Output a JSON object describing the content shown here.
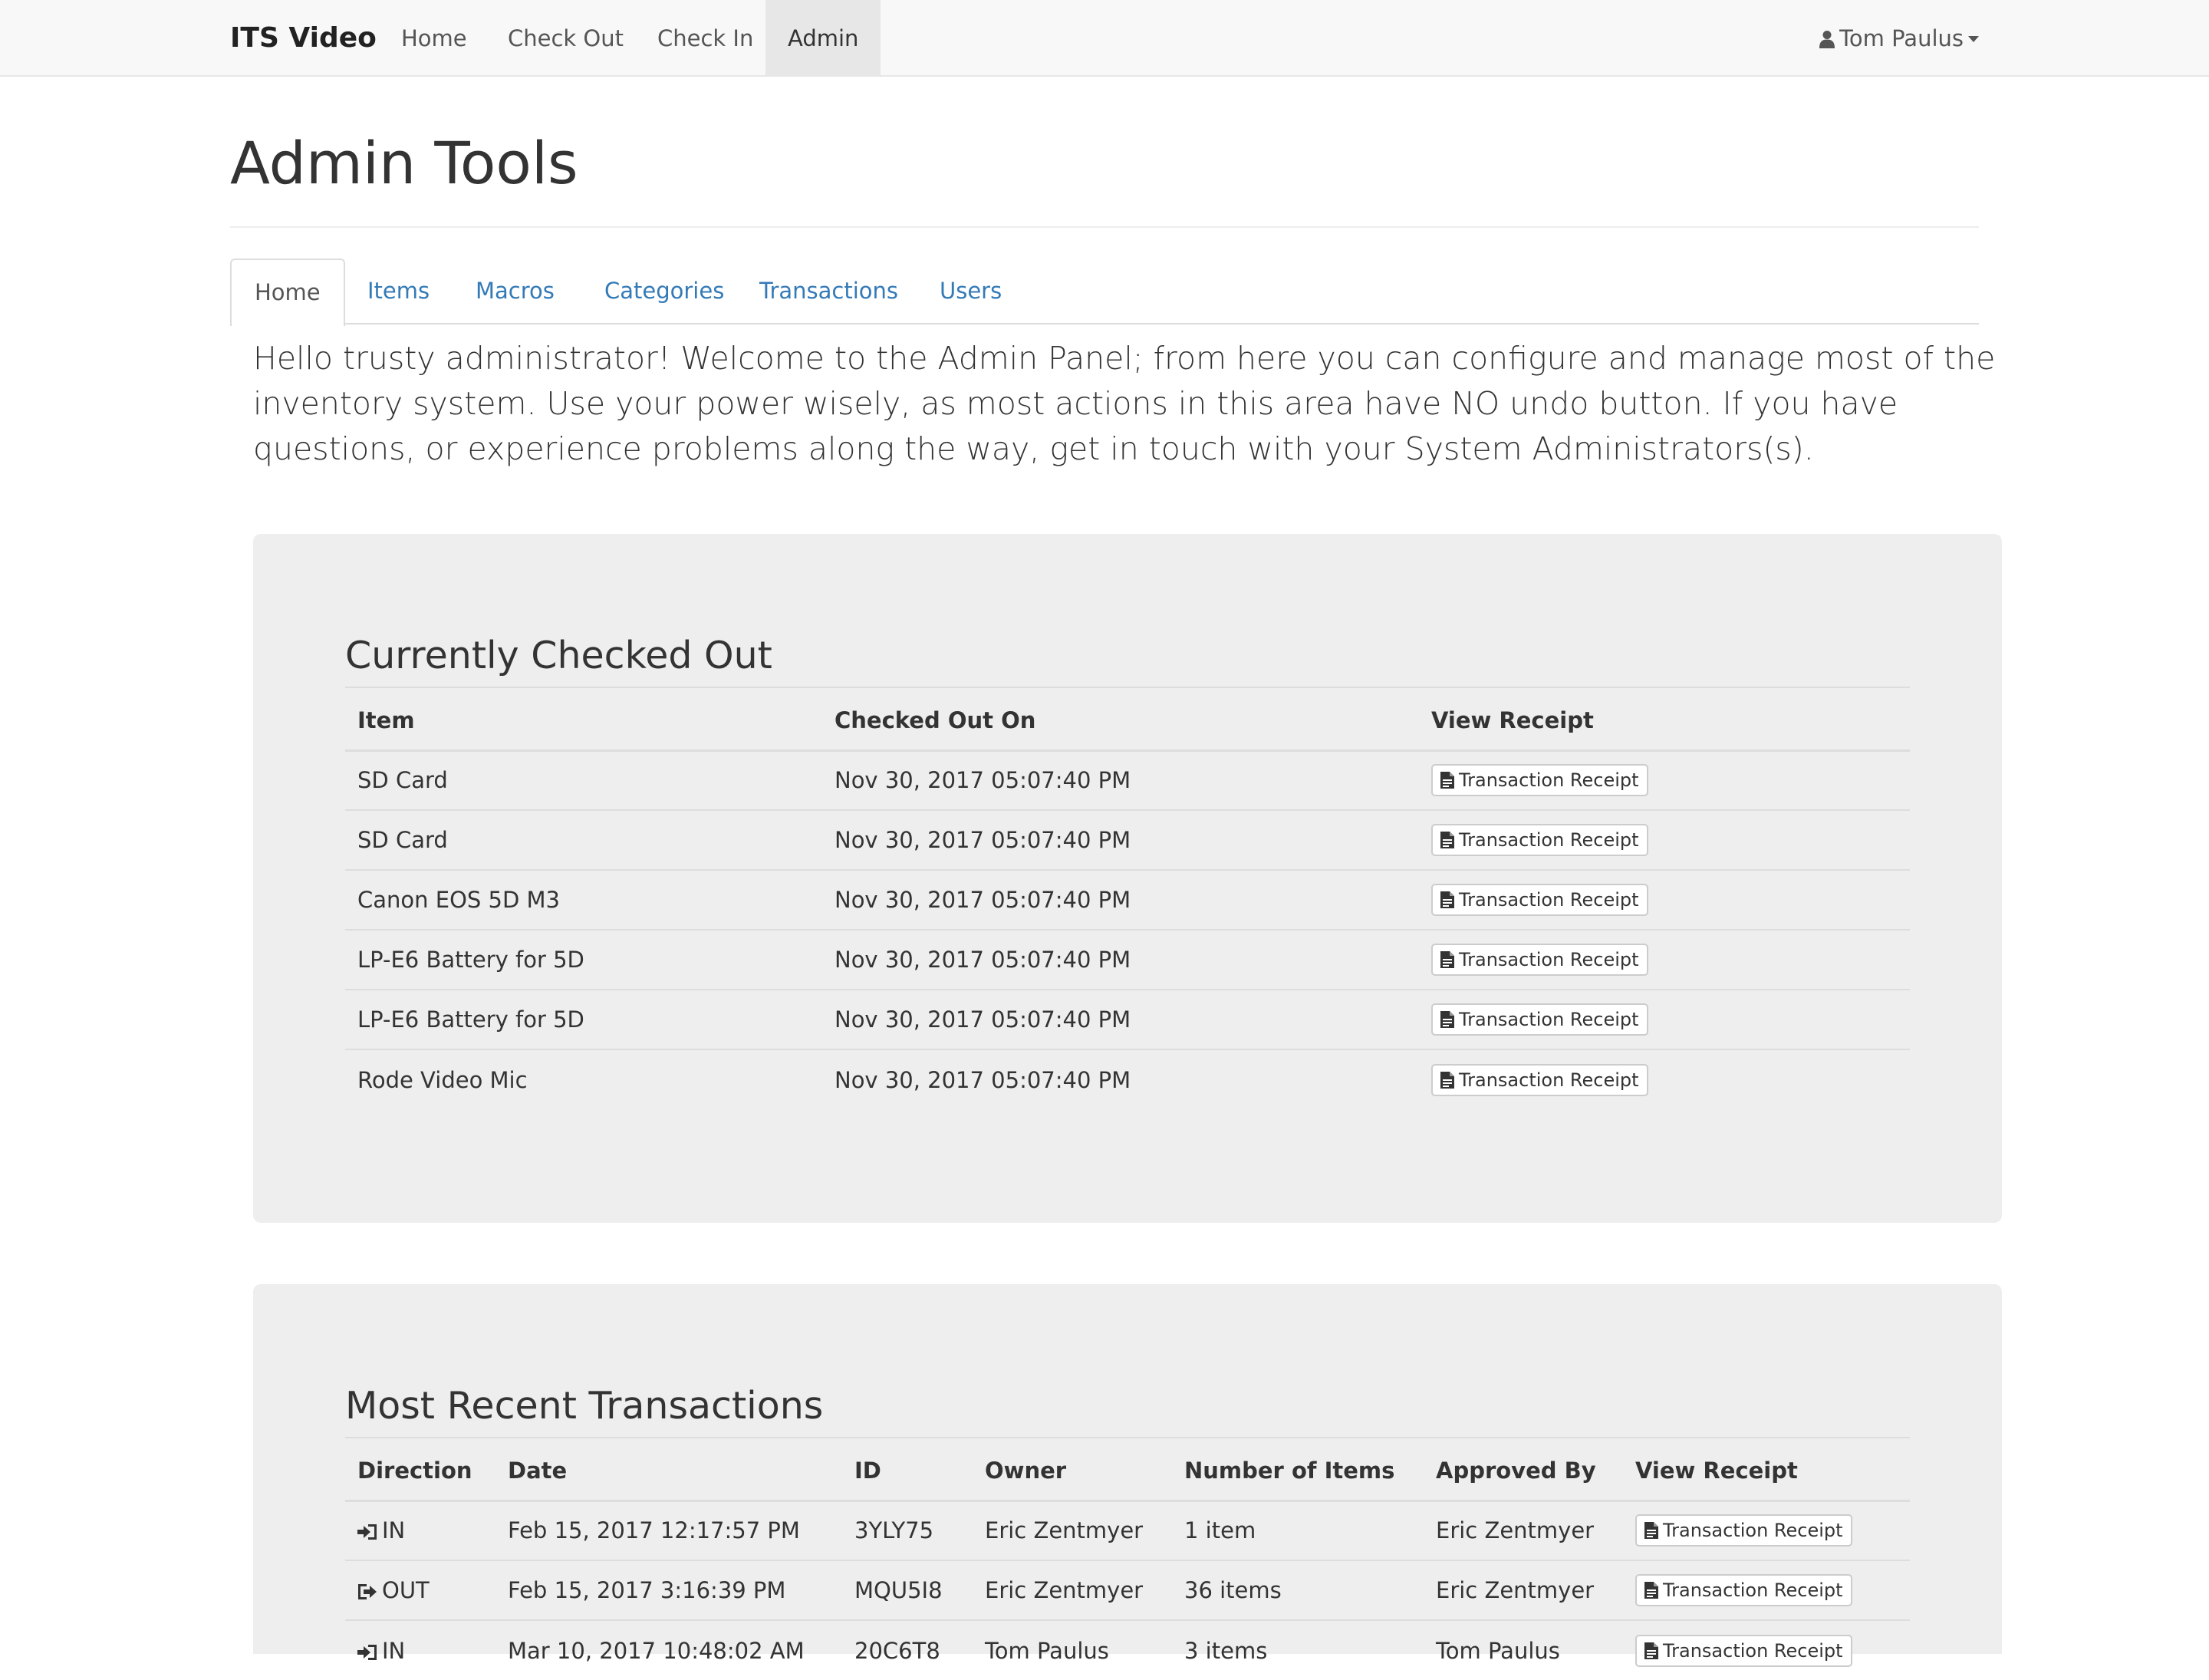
{
  "navbar": {
    "brand": "ITS Video",
    "items": [
      {
        "label": "Home"
      },
      {
        "label": "Check Out"
      },
      {
        "label": "Check In"
      },
      {
        "label": "Admin",
        "active": true
      }
    ],
    "user": {
      "name": "Tom Paulus",
      "icon": "user-icon"
    }
  },
  "page": {
    "title": "Admin Tools"
  },
  "tabs": [
    {
      "label": "Home",
      "active": true
    },
    {
      "label": "Items"
    },
    {
      "label": "Macros"
    },
    {
      "label": "Categories"
    },
    {
      "label": "Transactions"
    },
    {
      "label": "Users"
    }
  ],
  "intro": "Hello trusty administrator! Welcome to the Admin Panel; from here you can configure and manage most of the inventory system. Use your power wisely, as most actions in this area have NO undo button. If you have questions, or experience problems along the way, get in touch with your System Administrators(s).",
  "checked_out": {
    "title": "Currently Checked Out",
    "columns": [
      "Item",
      "Checked Out On",
      "View Receipt"
    ],
    "rows": [
      {
        "item": "SD Card",
        "date": "Nov 30, 2017 05:07:40 PM",
        "receipt": "Transaction Receipt"
      },
      {
        "item": "SD Card",
        "date": "Nov 30, 2017 05:07:40 PM",
        "receipt": "Transaction Receipt"
      },
      {
        "item": "Canon EOS 5D M3",
        "date": "Nov 30, 2017 05:07:40 PM",
        "receipt": "Transaction Receipt"
      },
      {
        "item": "LP-E6 Battery for 5D",
        "date": "Nov 30, 2017 05:07:40 PM",
        "receipt": "Transaction Receipt"
      },
      {
        "item": "LP-E6 Battery for 5D",
        "date": "Nov 30, 2017 05:07:40 PM",
        "receipt": "Transaction Receipt"
      },
      {
        "item": "Rode Video Mic",
        "date": "Nov 30, 2017 05:07:40 PM",
        "receipt": "Transaction Receipt"
      }
    ]
  },
  "recent": {
    "title": "Most Recent Transactions",
    "columns": [
      "Direction",
      "Date",
      "ID",
      "Owner",
      "Number of Items",
      "Approved By",
      "View Receipt"
    ],
    "rows": [
      {
        "direction": "IN",
        "icon": "sign-in-icon",
        "date": "Feb 15, 2017 12:17:57 PM",
        "id": "3YLY75",
        "owner": "Eric Zentmyer",
        "count": "1 item",
        "approved": "Eric Zentmyer",
        "receipt": "Transaction Receipt"
      },
      {
        "direction": "OUT",
        "icon": "sign-out-icon",
        "date": "Feb 15, 2017 3:16:39 PM",
        "id": "MQU5I8",
        "owner": "Eric Zentmyer",
        "count": "36 items",
        "approved": "Eric Zentmyer",
        "receipt": "Transaction Receipt"
      },
      {
        "direction": "IN",
        "icon": "sign-in-icon",
        "date": "Mar 10, 2017 10:48:02 AM",
        "id": "20C6T8",
        "owner": "Tom Paulus",
        "count": "3 items",
        "approved": "Tom Paulus",
        "receipt": "Transaction Receipt"
      }
    ]
  },
  "colors": {
    "link": "#337ab7",
    "well": "#eeeeee",
    "navbar": "#f8f8f8"
  }
}
